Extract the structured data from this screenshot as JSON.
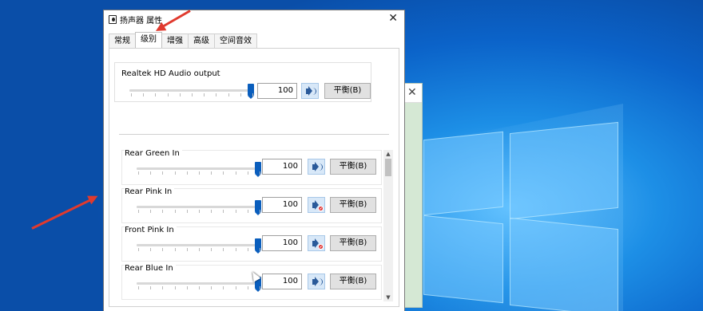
{
  "window": {
    "title": "扬声器 属性",
    "close_glyph": "✕"
  },
  "tabs": [
    {
      "label": "常规"
    },
    {
      "label": "级别"
    },
    {
      "label": "增强"
    },
    {
      "label": "高级"
    },
    {
      "label": "空间音效"
    }
  ],
  "active_tab": "级别",
  "output": {
    "label": "Realtek HD Audio output",
    "value": "100",
    "level": 1.0,
    "muted": false,
    "balance_label": "平衡(B)"
  },
  "inputs": [
    {
      "label": "Rear Green In",
      "value": "100",
      "level": 1.0,
      "muted": false,
      "balance_label": "平衡(B)"
    },
    {
      "label": "Rear Pink In",
      "value": "100",
      "level": 1.0,
      "muted": true,
      "balance_label": "平衡(B)"
    },
    {
      "label": "Front Pink In",
      "value": "100",
      "level": 1.0,
      "muted": true,
      "balance_label": "平衡(B)"
    },
    {
      "label": "Rear Blue In",
      "value": "100",
      "level": 1.0,
      "muted": false,
      "balance_label": "平衡(B)"
    }
  ],
  "scrollbar": {
    "up_glyph": "▲",
    "down_glyph": "▼"
  },
  "back_window": {
    "close_glyph": "✕"
  },
  "icons": {
    "speaker": "speaker-icon",
    "speaker_muted": "speaker-muted-icon",
    "title_icon": "speaker-device-icon"
  },
  "colors": {
    "slider_thumb": "#0a5ebd",
    "annotation_arrow": "#e03a2e",
    "mute_badge": "#e03030"
  }
}
